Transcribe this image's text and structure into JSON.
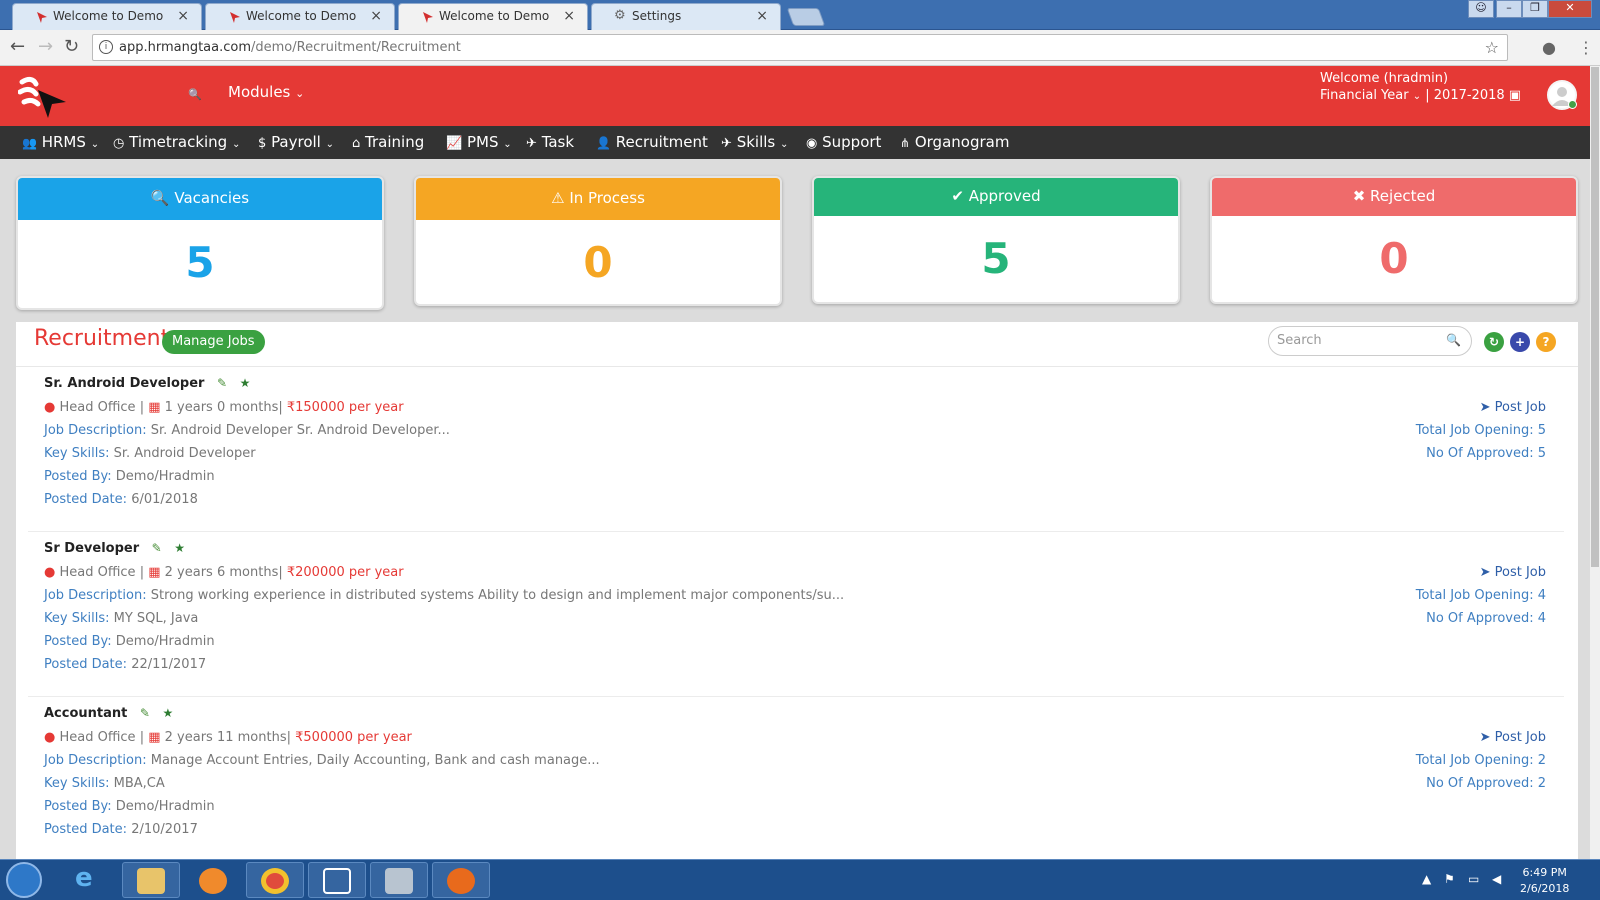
{
  "browser": {
    "tabs": [
      {
        "title": "Welcome to Demo",
        "close": "×"
      },
      {
        "title": "Welcome to Demo",
        "close": "×"
      },
      {
        "title": "Welcome to Demo",
        "close": "×"
      },
      {
        "title": "Settings",
        "close": "×"
      }
    ],
    "url_host": "app.hrmangtaa.com",
    "url_path": "/demo/Recruitment/Recruitment"
  },
  "header": {
    "modules_label": "Modules",
    "welcome_text": "Welcome (hradmin)",
    "financial_year_label": "Financial Year",
    "financial_year_value": "| 2017-2018"
  },
  "nav": {
    "items": [
      {
        "label": "HRMS",
        "icon": "users-icon",
        "dropdown": true
      },
      {
        "label": "Timetracking",
        "icon": "clock-icon",
        "dropdown": true
      },
      {
        "label": "Payroll",
        "icon": "dollar-icon",
        "dropdown": true
      },
      {
        "label": "Training",
        "icon": "bank-icon",
        "dropdown": false
      },
      {
        "label": "PMS",
        "icon": "line-chart-icon",
        "dropdown": true
      },
      {
        "label": "Task",
        "icon": "plane-icon",
        "dropdown": false
      },
      {
        "label": "Recruitment",
        "icon": "user-plus-icon",
        "dropdown": false
      },
      {
        "label": "Skills",
        "icon": "plane-icon",
        "dropdown": true
      },
      {
        "label": "Support",
        "icon": "lifebuoy-icon",
        "dropdown": false
      },
      {
        "label": "Organogram",
        "icon": "sitemap-icon",
        "dropdown": false
      }
    ]
  },
  "stats": [
    {
      "label": "Vacancies",
      "value": "5",
      "color": "#1aa3e8",
      "icon": "search-user-icon"
    },
    {
      "label": "In Process",
      "value": "0",
      "color": "#f5a623",
      "icon": "warning-icon"
    },
    {
      "label": "Approved",
      "value": "5",
      "color": "#26b47a",
      "icon": "check-icon"
    },
    {
      "label": "Rejected",
      "value": "0",
      "color": "#ef6b6b",
      "icon": "times-icon"
    }
  ],
  "panel": {
    "title": "Recruitment",
    "manage_jobs_label": "Manage Jobs",
    "search_placeholder": "Search"
  },
  "labels": {
    "job_description": "Job Description:",
    "key_skills": "Key Skills:",
    "posted_by": "Posted By:",
    "posted_date": "Posted Date:",
    "post_job": "Post Job"
  },
  "jobs": [
    {
      "title": "Sr. Android Developer",
      "location": "Head Office",
      "experience": "1 years   0 months|",
      "salary": "₹150000 per year",
      "description": "Sr. Android Developer Sr. Android Developer...",
      "skills": "Sr. Android Developer",
      "posted_by": "Demo/Hradmin",
      "posted_date": "6/01/2018",
      "total_openings": "Total Job Opening: 5",
      "approved": "No Of Approved: 5"
    },
    {
      "title": "Sr Developer",
      "location": "Head Office",
      "experience": "2 years   6 months|",
      "salary": "₹200000 per year",
      "description": "Strong working experience in distributed systems Ability to design and implement major components/su...",
      "skills": "MY SQL, Java",
      "posted_by": "Demo/Hradmin",
      "posted_date": "22/11/2017",
      "total_openings": "Total Job Opening: 4",
      "approved": "No Of Approved: 4"
    },
    {
      "title": "Accountant",
      "location": "Head Office",
      "experience": "2 years   11 months|",
      "salary": "₹500000 per year",
      "description": "Manage Account Entries, Daily Accounting, Bank and cash manage...",
      "skills": "MBA,CA",
      "posted_by": "Demo/Hradmin",
      "posted_date": "2/10/2017",
      "total_openings": "Total Job Opening: 2",
      "approved": "No Of Approved: 2"
    }
  ],
  "taskbar": {
    "time": "6:49 PM",
    "date": "2/6/2018"
  }
}
